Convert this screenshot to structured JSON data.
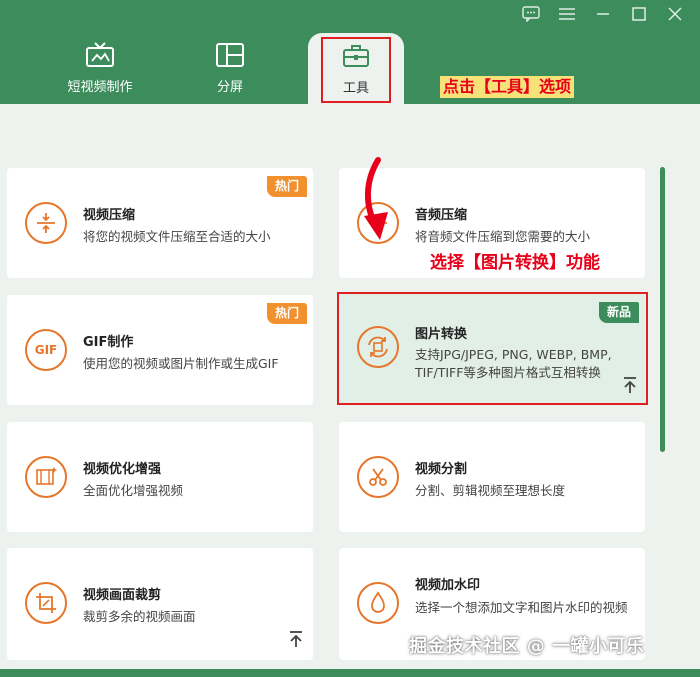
{
  "window_controls": [
    "chat-icon",
    "menu-icon",
    "minimize-icon",
    "maximize-icon",
    "close-icon"
  ],
  "tabs": [
    {
      "label": "短视频制作",
      "icon": "tv-icon"
    },
    {
      "label": "分屏",
      "icon": "split-screen-icon"
    },
    {
      "label": "工具",
      "icon": "toolbox-icon",
      "selected": true
    }
  ],
  "annotations": {
    "click_tools": "点击【工具】选项",
    "select_image": "选择【图片转换】功能"
  },
  "cards": [
    {
      "title": "视频压缩",
      "desc": "将您的视频文件压缩至合适的大小",
      "badge": "热门",
      "icon": "compress-icon"
    },
    {
      "title": "音频压缩",
      "desc": "将音频文件压缩到您需要的大小",
      "icon": "audio-compress-icon"
    },
    {
      "title": "GIF制作",
      "desc": "使用您的视频或图片制作或生成GIF",
      "badge": "热门",
      "icon": "gif-icon"
    },
    {
      "title": "图片转换",
      "desc": "支持JPG/JPEG, PNG, WEBP, BMP, TIF/TIFF等多种图片格式互相转换",
      "badge": "新品",
      "icon": "image-convert-icon",
      "active": true
    },
    {
      "title": "视频优化增强",
      "desc": "全面优化增强视频",
      "icon": "enhance-icon"
    },
    {
      "title": "视频分割",
      "desc": "分割、剪辑视频至理想长度",
      "icon": "scissors-icon"
    },
    {
      "title": "视频画面裁剪",
      "desc": "裁剪多余的视频画面",
      "icon": "crop-icon"
    },
    {
      "title": "视频加水印",
      "desc": "选择一个想添加文字和图片水印的视频",
      "icon": "watermark-drop-icon"
    }
  ],
  "watermark": "掘金技术社区 @ 一罐小可乐",
  "colors": {
    "brand_green": "#3c8c5c",
    "accent_orange": "#e6762a",
    "hot_badge": "#f0902e",
    "annotation_red": "#e8001a"
  }
}
